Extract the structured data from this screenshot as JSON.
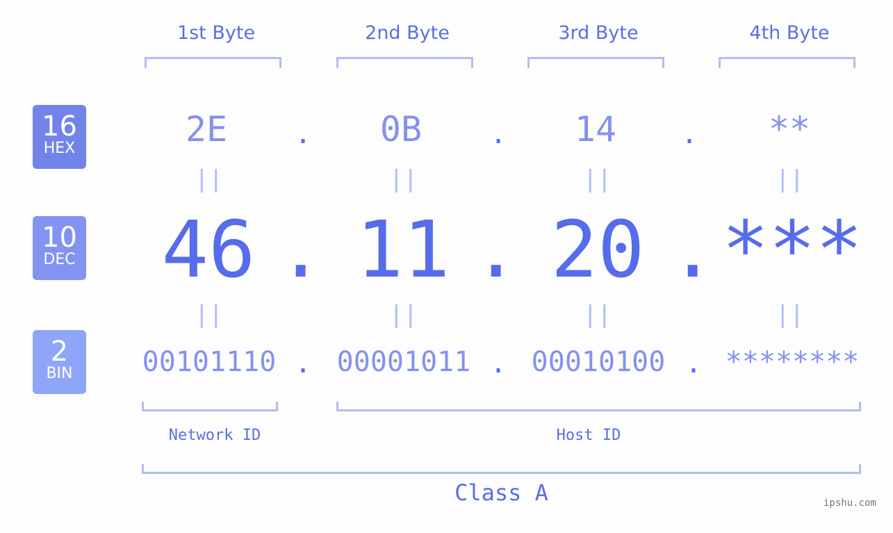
{
  "bytes": {
    "labels": [
      "1st Byte",
      "2nd Byte",
      "3rd Byte",
      "4th Byte"
    ]
  },
  "badges": {
    "hex": {
      "num": "16",
      "label": "HEX",
      "color": "#7283ea"
    },
    "dec": {
      "num": "10",
      "label": "DEC",
      "color": "#8393f2"
    },
    "bin": {
      "num": "2",
      "label": "BIN",
      "color": "#8fa5f8"
    }
  },
  "hex": [
    "2E",
    "0B",
    "14",
    "**"
  ],
  "dec": [
    "46",
    "11",
    "20",
    "***"
  ],
  "bin": [
    "00101110",
    "00001011",
    "00010100",
    "********"
  ],
  "separator": ".",
  "equals": "||",
  "network_label": "Network ID",
  "host_label": "Host ID",
  "class_label": "Class A",
  "watermark": "ipshu.com",
  "colors": {
    "accent": "#566ceb",
    "light_accent": "#8591ee",
    "bracket": "#b1bcf6"
  }
}
